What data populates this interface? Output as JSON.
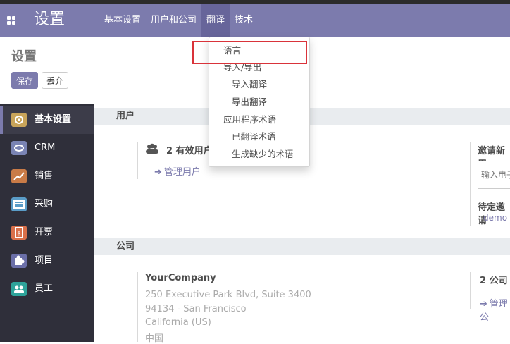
{
  "navbar": {
    "app_title": "设置",
    "menu": [
      "基本设置",
      "用户和公司",
      "翻译",
      "技术"
    ],
    "active_menu": "翻译"
  },
  "control_panel": {
    "title": "设置",
    "save_label": "保存",
    "discard_label": "丢弃"
  },
  "sidebar": {
    "items": [
      {
        "label": "基本设置",
        "icon": "gear-icon",
        "color": "#c8a45a"
      },
      {
        "label": "CRM",
        "icon": "handshake-icon",
        "color": "#7a84b4"
      },
      {
        "label": "销售",
        "icon": "chart-icon",
        "color": "#c97b47"
      },
      {
        "label": "采购",
        "icon": "card-icon",
        "color": "#5a9cc7"
      },
      {
        "label": "开票",
        "icon": "invoice-icon",
        "color": "#d9704a"
      },
      {
        "label": "项目",
        "icon": "puzzle-icon",
        "color": "#6b6fa8"
      },
      {
        "label": "员工",
        "icon": "users-icon",
        "color": "#2ea39a"
      }
    ]
  },
  "users_section": {
    "title": "用户",
    "active_users": "2 有效用户",
    "manage_users": "管理用户",
    "invite_label": "邀请新用",
    "email_placeholder": "输入电子",
    "pending_label": "待定邀请",
    "pending_user": "demo"
  },
  "company_section": {
    "title": "公司",
    "name": "YourCompany",
    "address": [
      "250 Executive Park Blvd, Suite 3400",
      "94134 - San Francisco",
      "California (US)",
      "中国"
    ],
    "count": "2 公司",
    "manage": "管理公"
  },
  "translate_menu": {
    "items": [
      {
        "label": "语言",
        "sub": false
      },
      {
        "label": "导入/导出",
        "sub": false
      },
      {
        "label": "导入翻译",
        "sub": true
      },
      {
        "label": "导出翻译",
        "sub": true
      },
      {
        "label": "应用程序术语",
        "sub": false
      },
      {
        "label": "已翻译术语",
        "sub": true
      },
      {
        "label": "生成缺少的术语",
        "sub": true
      }
    ]
  },
  "colors": {
    "brand": "#7c7bad",
    "highlight": "#d9333a"
  }
}
